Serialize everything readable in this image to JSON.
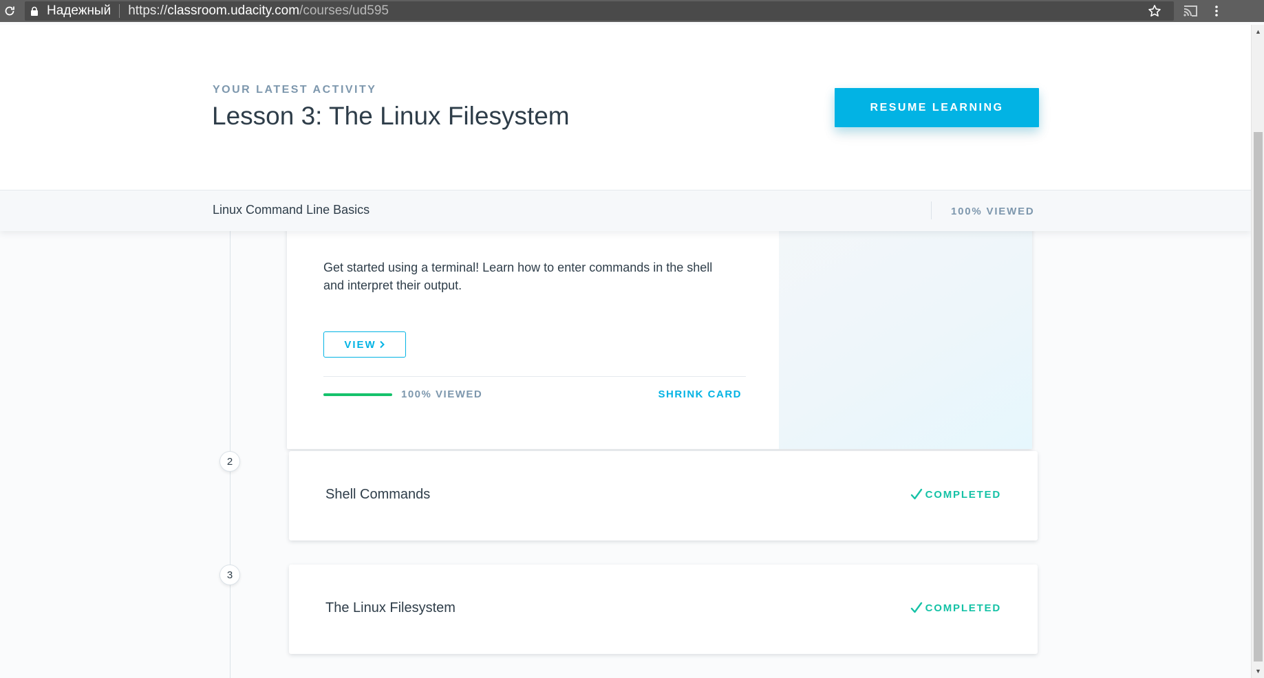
{
  "browser": {
    "secure_label": "Надежный",
    "url_scheme": "https://",
    "url_host": "classroom.udacity.com",
    "url_path": "/courses/ud595"
  },
  "header": {
    "activity_label": "YOUR LATEST ACTIVITY",
    "activity_title": "Lesson 3: The Linux Filesystem",
    "resume_label": "RESUME LEARNING"
  },
  "subheader": {
    "course_name": "Linux Command Line Basics",
    "course_viewed": "100% VIEWED"
  },
  "lessons": [
    {
      "description": "Get started using a terminal! Learn how to enter commands in the shell and interpret their output.",
      "view_label": "VIEW",
      "progress": 1.0,
      "progress_label": "100% VIEWED",
      "shrink_label": "SHRINK CARD"
    },
    {
      "number": "2",
      "title": "Shell Commands",
      "status": "COMPLETED"
    },
    {
      "number": "3",
      "title": "The Linux Filesystem",
      "status": "COMPLETED"
    }
  ],
  "colors": {
    "accent": "#02b3e4",
    "completed": "#15c2a6",
    "progress": "#15c26b",
    "text": "#2e3d49",
    "muted": "#7d97ad"
  }
}
